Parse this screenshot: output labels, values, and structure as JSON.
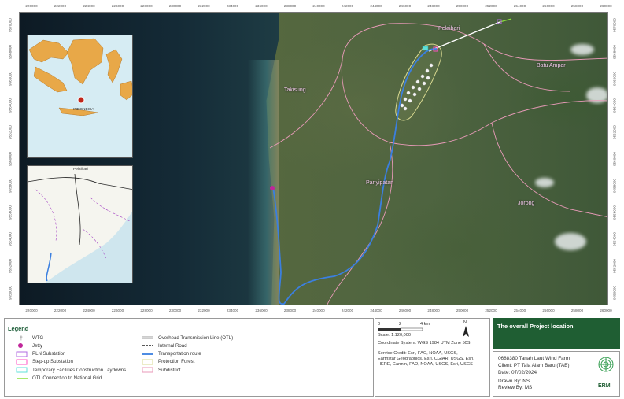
{
  "map": {
    "x_ticks": [
      "220000",
      "222000",
      "224000",
      "226000",
      "228000",
      "230000",
      "232000",
      "234000",
      "236000",
      "238000",
      "240000",
      "242000",
      "244000",
      "246000",
      "248000",
      "250000",
      "252000",
      "254000",
      "256000",
      "258000",
      "260000"
    ],
    "y_ticks": [
      "9570000",
      "9568000",
      "9566000",
      "9564000",
      "9562000",
      "9560000",
      "9558000",
      "9556000",
      "9554000",
      "9552000",
      "9550000"
    ],
    "places": {
      "pelaihari": "Pelaihari",
      "batu_ampar": "Batu Ampar",
      "takisung": "Takisung",
      "panyipatan": "Panyipatan",
      "jorong": "Jorong"
    },
    "inset1_label": "INDONESIA",
    "inset2_label": "Pelaihari",
    "colors": {
      "transport_route": "#3b7fe0",
      "subdistrict": "#e89ab8",
      "protection_forest": "#d8d890",
      "otl_grid": "#8be03b",
      "jetty": "#c0269a",
      "brand_green": "#1f5e33"
    }
  },
  "legend": {
    "title": "Legend",
    "left": [
      {
        "label": "WTG",
        "icon": "wtg-icon"
      },
      {
        "label": "Jetty",
        "icon": "jetty-dot-icon"
      },
      {
        "label": "PLN Substation",
        "icon": "pln-substation-box"
      },
      {
        "label": "Step-up Substation",
        "icon": "stepup-substation-box"
      },
      {
        "label": "Temporary Facilities Construction Laydowns",
        "icon": "laydown-box"
      },
      {
        "label": "OTL Connection to National Grid",
        "icon": "otl-grid-line"
      }
    ],
    "right": [
      {
        "label": "Overhead Transmission Line (OTL)",
        "icon": "otl-line"
      },
      {
        "label": "Internal Road",
        "icon": "internal-road-line"
      },
      {
        "label": "Transportation route",
        "icon": "transport-route-line"
      },
      {
        "label": "Protection Forest",
        "icon": "protection-forest-box"
      },
      {
        "label": "Subdistrict",
        "icon": "subdistrict-box"
      }
    ]
  },
  "scale": {
    "ticks": [
      "0",
      "2",
      "4 km"
    ],
    "north": "N",
    "ratio": "Scale:   1:120,000",
    "crs": "Coordinate System: WGS 1984 UTM Zone 50S",
    "credit": [
      "Service Credit: Esri, FAO, NOAA, USGS,",
      "Earthstar Geographics, Esri, CGIAR, USGS, Esri,",
      "HERE, Garmin, FAO, NOAA, USGS, Esri, USGS"
    ]
  },
  "title_block": {
    "title": "The overall Project location",
    "project": "0688380 Tanah Laut Wind Farm",
    "client": "Client: PT Tala Alam Baru (TAB)",
    "date": "Date: 07/02/2024",
    "drawn": "Drawn By:    NS",
    "review": "Review By:   MS",
    "logo_text": "ERM"
  }
}
